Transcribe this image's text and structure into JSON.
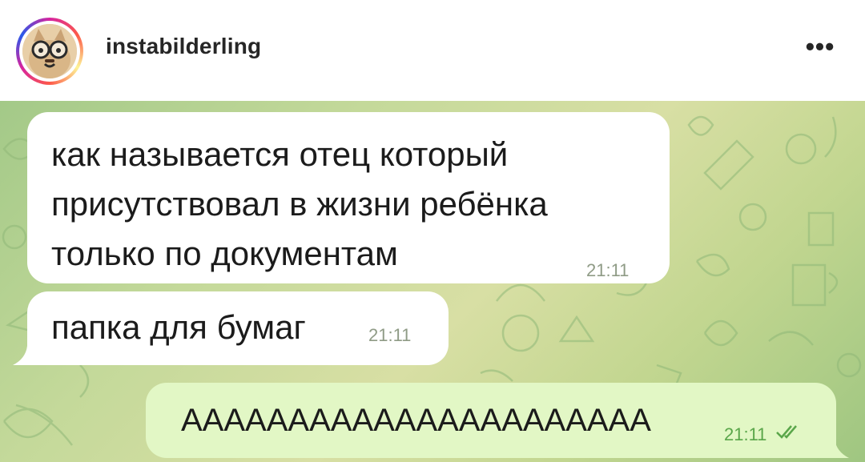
{
  "post": {
    "username": "instabilderling",
    "more_icon": "more-horizontal-icon",
    "more_label": "•••"
  },
  "chat": {
    "messages": [
      {
        "direction": "incoming",
        "lines": [
          "как называется отец который",
          "присутствовал в жизни ребёнка",
          "только по документам"
        ],
        "time": "21:11"
      },
      {
        "direction": "incoming",
        "lines": [
          "папка для бумаг"
        ],
        "time": "21:11"
      },
      {
        "direction": "outgoing",
        "lines": [
          "АААААААААААААААААААААА"
        ],
        "time": "21:11",
        "status_icon": "double-check-icon"
      }
    ]
  },
  "colors": {
    "incoming_bubble": "#ffffff",
    "outgoing_bubble": "#e2f7c5",
    "outgoing_time": "#5aa64a",
    "chat_background": "#c4d99a"
  }
}
